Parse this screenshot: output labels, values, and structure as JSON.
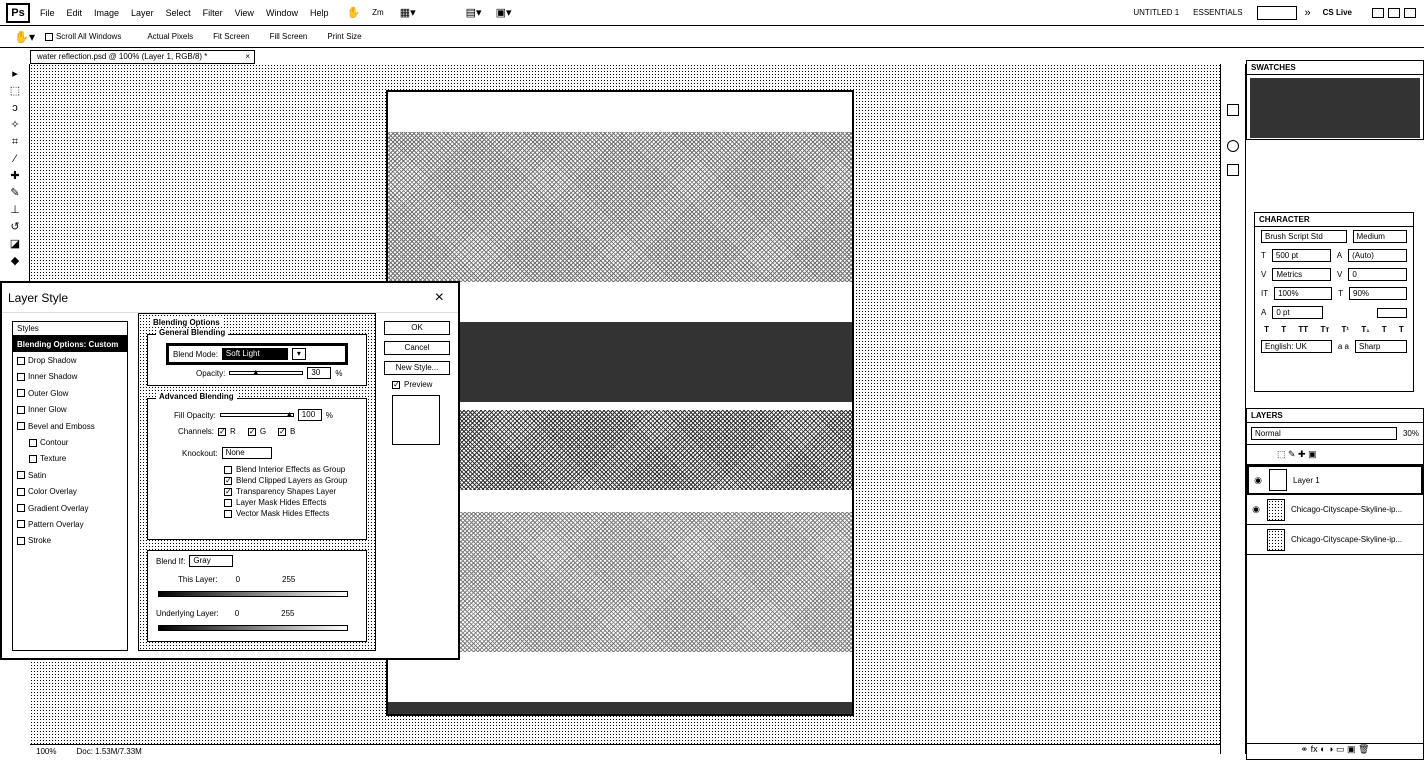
{
  "menubar": {
    "logo": "Ps",
    "items": [
      "File",
      "Edit",
      "Image",
      "Layer",
      "Select",
      "Filter",
      "View",
      "Window",
      "Help"
    ],
    "zoom": "Zm",
    "workspace": [
      "UNTITLED 1",
      "ESSENTIALS"
    ],
    "extras": [
      "»",
      "CS Live"
    ]
  },
  "options": {
    "scroll_all": "Scroll All Windows",
    "buttons": [
      "Actual Pixels",
      "Fit Screen",
      "Fill Screen",
      "Print Size"
    ]
  },
  "document": {
    "tab": "water reflection.psd @ 100% (Layer 1, RGB/8) *"
  },
  "status": {
    "zoom": "100%",
    "doc": "Doc: 1.53M/7.33M"
  },
  "swatches": {
    "title": "SWATCHES"
  },
  "character": {
    "title": "CHARACTER",
    "font": "Brush Script Std",
    "style": "Medium",
    "size": "500 pt",
    "leading": "(Auto)",
    "kerning": "Metrics",
    "tracking": "0",
    "vscale": "100%",
    "hscale": "90%",
    "baseline": "0 pt",
    "language": "English: UK",
    "aa": "Sharp",
    "aa_prefix": "a a"
  },
  "layers": {
    "title": "LAYERS",
    "mode": "Normal",
    "opacity": "30%",
    "items": [
      {
        "name": "Layer 1"
      },
      {
        "name": "Chicago-Cityscape-Skyline-ip..."
      },
      {
        "name": "Chicago-Cityscape-Skyline-ip..."
      }
    ]
  },
  "dialog": {
    "title": "Layer Style",
    "close": "×",
    "styles_header": "Styles",
    "styles": [
      {
        "label": "Blending Options: Custom",
        "has_cb": false,
        "selected": true,
        "indent": false
      },
      {
        "label": "Drop Shadow",
        "has_cb": true,
        "indent": false
      },
      {
        "label": "Inner Shadow",
        "has_cb": true,
        "indent": false
      },
      {
        "label": "Outer Glow",
        "has_cb": true,
        "indent": false
      },
      {
        "label": "Inner Glow",
        "has_cb": true,
        "indent": false
      },
      {
        "label": "Bevel and Emboss",
        "has_cb": true,
        "indent": false
      },
      {
        "label": "Contour",
        "has_cb": true,
        "indent": true
      },
      {
        "label": "Texture",
        "has_cb": true,
        "indent": true
      },
      {
        "label": "Satin",
        "has_cb": true,
        "indent": false
      },
      {
        "label": "Color Overlay",
        "has_cb": true,
        "indent": false
      },
      {
        "label": "Gradient Overlay",
        "has_cb": true,
        "indent": false
      },
      {
        "label": "Pattern Overlay",
        "has_cb": true,
        "indent": false
      },
      {
        "label": "Stroke",
        "has_cb": true,
        "indent": false
      }
    ],
    "blending_options": "Blending Options",
    "general": {
      "label": "General Blending",
      "blend_mode_label": "Blend Mode:",
      "blend_mode": "Soft Light",
      "opacity_label": "Opacity:",
      "opacity": "30",
      "percent": "%"
    },
    "advanced": {
      "label": "Advanced Blending",
      "fill_label": "Fill Opacity:",
      "fill": "100",
      "percent": "%",
      "channels_label": "Channels:",
      "channels": [
        "R",
        "G",
        "B"
      ],
      "knockout_label": "Knockout:",
      "knockout": "None",
      "checks": [
        {
          "label": "Blend Interior Effects as Group",
          "checked": false
        },
        {
          "label": "Blend Clipped Layers as Group",
          "checked": true
        },
        {
          "label": "Transparency Shapes Layer",
          "checked": true
        },
        {
          "label": "Layer Mask Hides Effects",
          "checked": false
        },
        {
          "label": "Vector Mask Hides Effects",
          "checked": false
        }
      ]
    },
    "blend_if": {
      "label": "Blend If:",
      "value": "Gray",
      "this_layer": "This Layer:",
      "underlying": "Underlying Layer:",
      "low": "0",
      "high": "255"
    },
    "buttons": {
      "ok": "OK",
      "cancel": "Cancel",
      "new_style": "New Style...",
      "preview": "Preview"
    }
  }
}
